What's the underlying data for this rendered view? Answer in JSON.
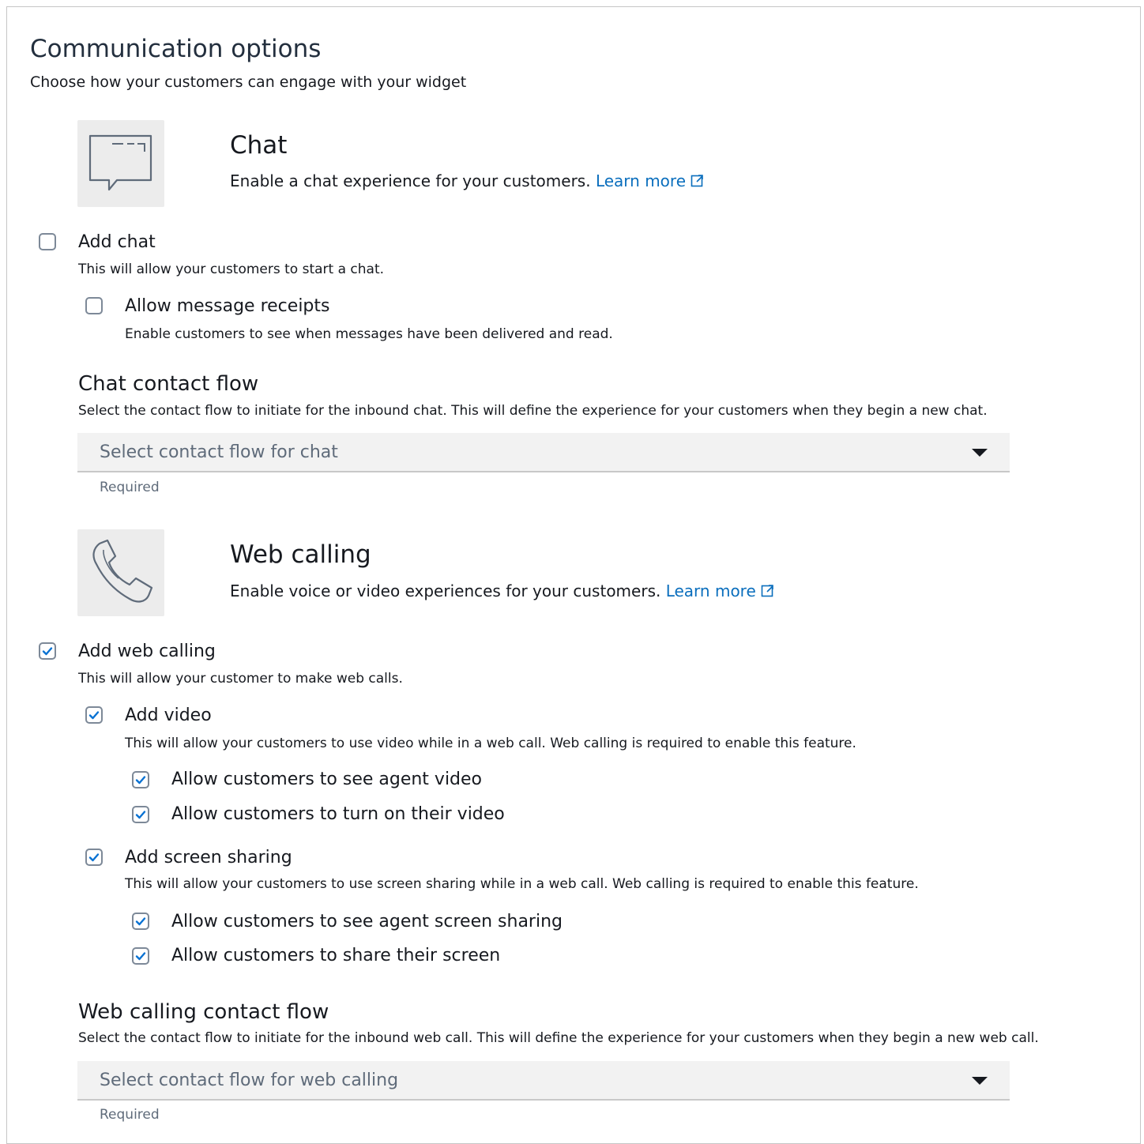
{
  "section": {
    "title": "Communication options",
    "subtitle": "Choose how your customers can engage with your widget"
  },
  "chat": {
    "icon": "chat-bubble-icon",
    "title": "Chat",
    "description": "Enable a chat experience for your customers.",
    "learn_more": "Learn more",
    "add_chat": {
      "label": "Add chat",
      "checked": false,
      "description": "This will allow your customers to start a chat."
    },
    "message_receipts": {
      "label": "Allow message receipts",
      "checked": false,
      "description": "Enable customers to see when messages have been delivered and read."
    },
    "contact_flow": {
      "title": "Chat contact flow",
      "description": "Select the contact flow to initiate for the inbound chat. This will define the experience for your customers when they begin a new chat.",
      "placeholder": "Select contact flow for chat",
      "hint": "Required"
    }
  },
  "web_calling": {
    "icon": "phone-icon",
    "title": "Web calling",
    "description": "Enable voice or video experiences for your customers.",
    "learn_more": "Learn more",
    "add_web_calling": {
      "label": "Add web calling",
      "checked": true,
      "description": "This will allow your customer to make web calls."
    },
    "add_video": {
      "label": "Add video",
      "checked": true,
      "description": "This will allow your customers to use video while in a web call. Web calling is required to enable this feature."
    },
    "see_agent_video": {
      "label": "Allow customers to see agent video",
      "checked": true
    },
    "turn_on_video": {
      "label": "Allow customers to turn on their video",
      "checked": true
    },
    "add_screen_sharing": {
      "label": "Add screen sharing",
      "checked": true,
      "description": "This will allow your customers to use screen sharing while in a web call. Web calling is required to enable this feature."
    },
    "see_agent_screen": {
      "label": "Allow customers to see agent screen sharing",
      "checked": true
    },
    "share_screen": {
      "label": "Allow customers to share their screen",
      "checked": true
    },
    "contact_flow": {
      "title": "Web calling contact flow",
      "description": "Select the contact flow to initiate for the inbound web call. This will define the experience for your customers when they begin a new web call.",
      "placeholder": "Select contact flow for web calling",
      "hint": "Required"
    }
  },
  "colors": {
    "link": "#0a6ebd",
    "checkbox_check": "#0972d3",
    "tile": "#ececec"
  }
}
